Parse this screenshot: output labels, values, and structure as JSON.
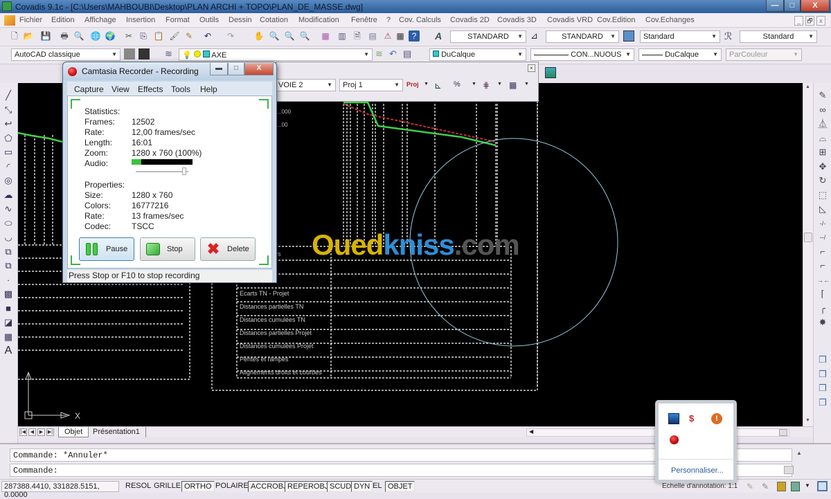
{
  "window": {
    "title": "Covadis 9.1c - [C:\\Users\\MAHBOUBI\\Desktop\\PLAN ARCHI + TOPO\\PLAN_DE_MASSE.dwg]",
    "minimize": "—",
    "maximize": "□",
    "close": "X"
  },
  "menubar": {
    "items": [
      "Fichier",
      "Edition",
      "Affichage",
      "Insertion",
      "Format",
      "Outils",
      "Dessin",
      "Cotation",
      "Modification",
      "Fenêtre",
      "?",
      "Cov. Calculs",
      "Covadis 2D",
      "Covadis 3D",
      "Covadis VRD",
      "Cov.Edition",
      "Cov.Echanges"
    ],
    "doc_controls": [
      "_",
      "🗗",
      "x"
    ]
  },
  "toolbar_standard": {
    "icons": [
      "new-icon",
      "open-icon",
      "save-icon",
      "print-icon",
      "print-preview-icon",
      "publish-icon",
      "plot-icon",
      "cut-icon",
      "copy-icon",
      "paste-icon",
      "match-properties-icon",
      "block-editor-icon",
      "undo-icon",
      "redo-icon",
      "pan-icon",
      "zoom-realtime-icon",
      "zoom-window-icon",
      "zoom-previous-icon",
      "properties-icon",
      "design-center-icon",
      "tool-palettes-icon",
      "sheet-set-icon",
      "markup-icon",
      "calculator-icon",
      "help-icon"
    ],
    "text_style": "STANDARD",
    "dim_style": "STANDARD",
    "table_style": "Standard",
    "multileader_style": "Standard"
  },
  "toolbar_layers": {
    "workspace": "AutoCAD classique",
    "layer": "AXE",
    "color": "DuCalque",
    "linetype": "CON...NUOUS",
    "lineweight": "DuCalque",
    "plotstyle": "ParCouleur"
  },
  "covadis_toolbar": {
    "axis": "VOIE 2",
    "projet": "Proj  1",
    "proj_label": "Proj"
  },
  "camtasia": {
    "title": "Camtasia Recorder - Recording",
    "menu": [
      "Capture",
      "View",
      "Effects",
      "Tools",
      "Help"
    ],
    "statistics_label": "Statistics:",
    "stats": [
      {
        "label": "Frames:",
        "value": "12502"
      },
      {
        "label": "Rate:",
        "value": "12,00 frames/sec"
      },
      {
        "label": "Length:",
        "value": "16:01"
      },
      {
        "label": "Zoom:",
        "value": "1280 x 760 (100%)"
      },
      {
        "label": "Audio:",
        "value": ""
      }
    ],
    "audio_level": 0.16,
    "audio_volume": 0.95,
    "properties_label": "Properties:",
    "properties": [
      {
        "label": "Size:",
        "value": "1280 x 760"
      },
      {
        "label": "Colors:",
        "value": "16777216"
      },
      {
        "label": "Rate:",
        "value": "13 frames/sec"
      },
      {
        "label": "Codec:",
        "value": "TSCC"
      }
    ],
    "buttons": {
      "pause": "Pause",
      "stop": "Stop",
      "delete": "Delete"
    },
    "status": "Press Stop or F10 to stop recording"
  },
  "drawing": {
    "table_rows": [
      "...ns en travers",
      "",
      "...l",
      "Ecarts TN - Projet",
      "Distances partielles TN",
      "Distances cumulées TN",
      "Distances partielles Projet",
      "Distances cumulées Projet",
      "Pentes et rampes",
      "Alignements droits et courbes"
    ],
    "labels": [
      "...000",
      "...00"
    ],
    "ucs_x": "X",
    "watermark_a": "Oued",
    "watermark_b": "kniss",
    "watermark_c": ".com"
  },
  "layout_tabs": [
    "Objet",
    "Présentation1"
  ],
  "command": {
    "history": "Commande: *Annuler*",
    "prompt": "Commande:"
  },
  "statusbar": {
    "coords": "287388.4410, 331828.5151, 0.0000",
    "toggles": [
      {
        "label": "RESOL",
        "on": false
      },
      {
        "label": "GRILLE",
        "on": false
      },
      {
        "label": "ORTHO",
        "on": true
      },
      {
        "label": "POLAIRE",
        "on": false
      },
      {
        "label": "ACCROBJ",
        "on": true
      },
      {
        "label": "REPEROBJ",
        "on": true
      },
      {
        "label": "SCUD",
        "on": true
      },
      {
        "label": "DYN",
        "on": true
      },
      {
        "label": "EL",
        "on": false
      },
      {
        "label": "OBJET",
        "on": true
      }
    ],
    "annotation_scale": "Echelle d'annotation:  1:1"
  },
  "tray_popup": {
    "icons": [
      "network-icon",
      "antivirus-icon",
      "warning-icon",
      "camtasia-record-icon"
    ],
    "customize": "Personnaliser..."
  },
  "colors": {
    "canvas_bg": "#000000",
    "profile_tn": "#c0303a",
    "profile_projet": "#3ecf4a",
    "circle": "#8fd0e0",
    "accent_green": "#3cb44a"
  }
}
